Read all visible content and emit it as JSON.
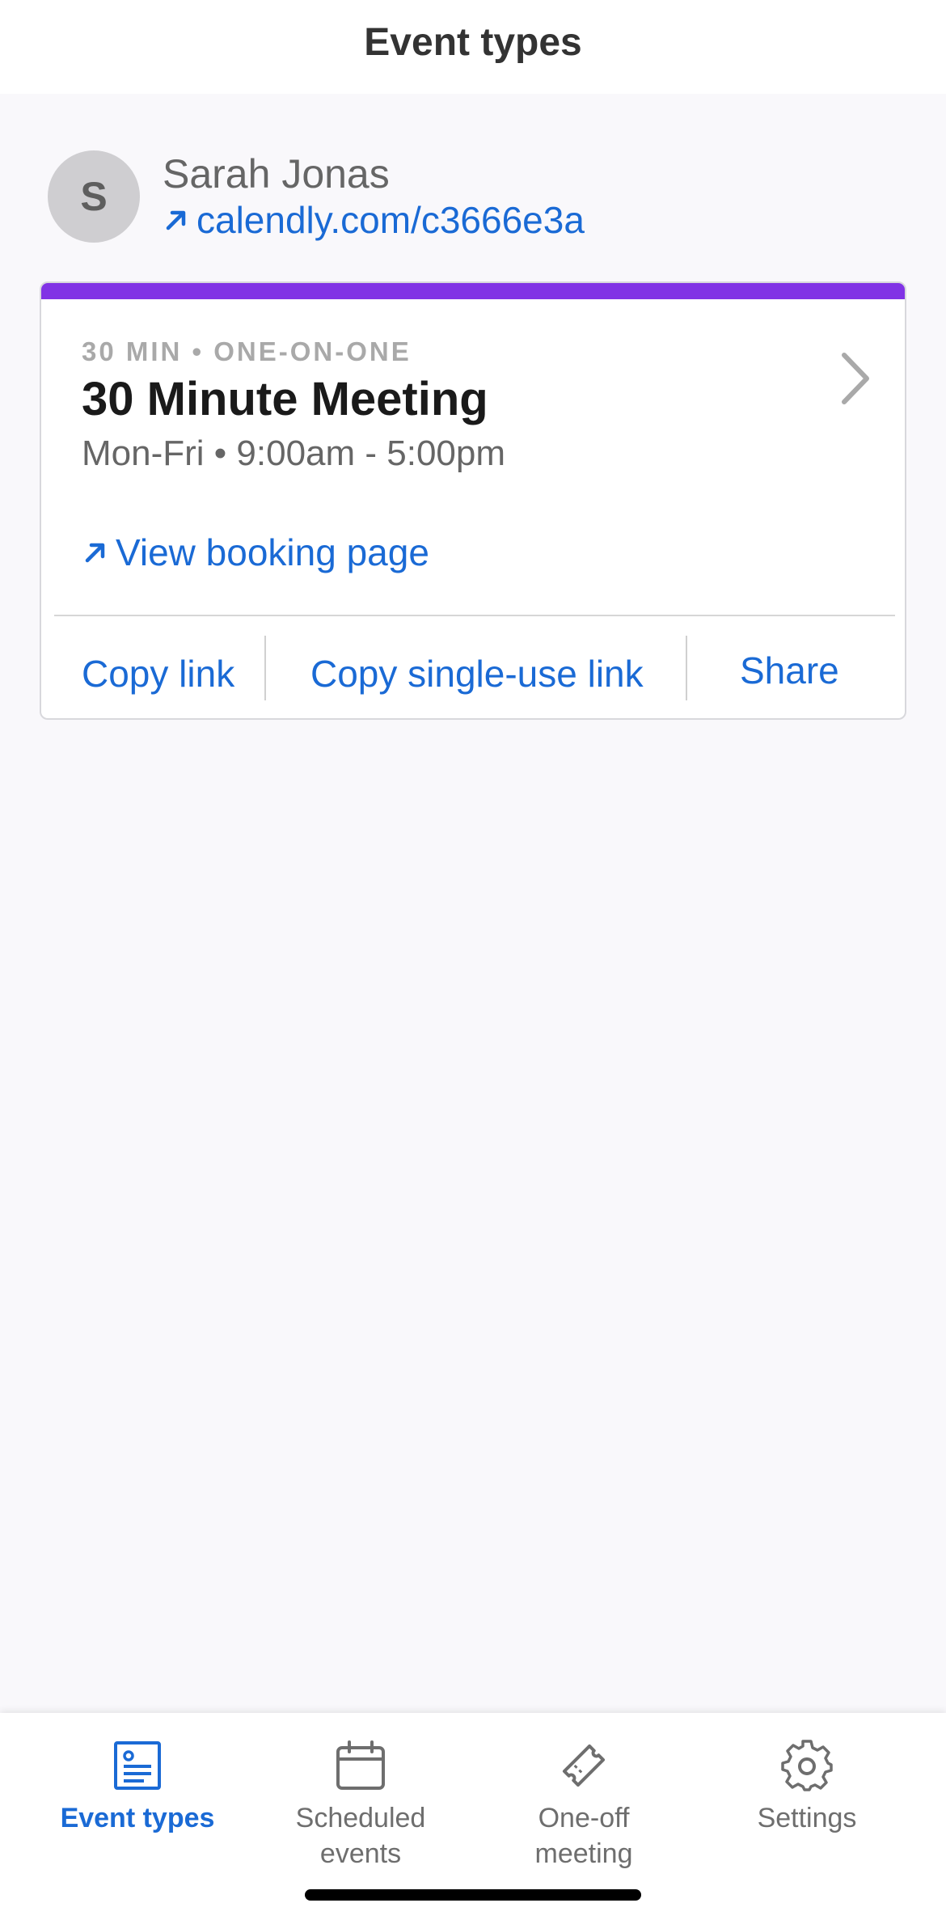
{
  "header": {
    "title": "Event types"
  },
  "profile": {
    "avatar_initial": "S",
    "name": "Sarah Jonas",
    "link": "calendly.com/c3666e3a"
  },
  "event_card": {
    "accent_color": "#8133e5",
    "meta": "30 MIN • ONE-ON-ONE",
    "title": "30 Minute Meeting",
    "hours": "Mon-Fri • 9:00am - 5:00pm",
    "booking_link": "View booking page",
    "actions": {
      "copy_link": "Copy link",
      "copy_single_use": "Copy single-use link",
      "share": "Share"
    }
  },
  "tabbar": {
    "items": [
      {
        "label": "Event types",
        "icon": "event-types-icon",
        "active": true
      },
      {
        "label": "Scheduled\nevents",
        "icon": "calendar-icon",
        "active": false
      },
      {
        "label": "One-off\nmeeting",
        "icon": "ticket-icon",
        "active": false
      },
      {
        "label": "Settings",
        "icon": "gear-icon",
        "active": false
      }
    ]
  },
  "colors": {
    "link_blue": "#1a6ad5",
    "accent_purple": "#8133e5",
    "background": "#f9f8fb"
  }
}
